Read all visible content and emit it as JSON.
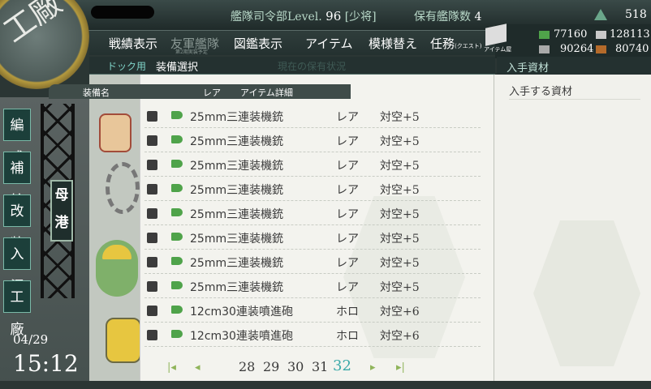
{
  "top": {
    "hq_label": "艦隊司令部Level.",
    "level": "96",
    "rank": "[少将]",
    "fleet_label": "保有艦隊数",
    "fleet_count": "4",
    "coins": "518"
  },
  "nav": {
    "items": [
      {
        "label": "戦績表示"
      },
      {
        "label": "友軍艦隊"
      },
      {
        "label": "図鑑表示"
      },
      {
        "label": "アイテム"
      },
      {
        "label": "模様替え"
      },
      {
        "label": "任務"
      }
    ],
    "friend_sub": "第2期実装予定",
    "quest_sub": "(クエスト)",
    "item_shop": "アイテム屋"
  },
  "resources": {
    "fuel": "77160",
    "ammo": "128113",
    "steel": "90264",
    "bauxite": "80740"
  },
  "crest": "工廠",
  "sub": {
    "dock": "ドック用",
    "equip": "装備選択",
    "faint": "現在の保有状況"
  },
  "right_title": "入手資材",
  "right_label": "入手する資材",
  "side": [
    "編成",
    "補給",
    "改装",
    "入渠",
    "工廠"
  ],
  "port": "母港",
  "clock": {
    "date": "04/29",
    "time": "15:12"
  },
  "table": {
    "col_name": "装備名",
    "col_rarity": "レア",
    "col_detail": "アイテム詳細",
    "rows": [
      {
        "name": "25mm三連装機銃",
        "rarity": "レア",
        "detail": "対空+5"
      },
      {
        "name": "25mm三連装機銃",
        "rarity": "レア",
        "detail": "対空+5"
      },
      {
        "name": "25mm三連装機銃",
        "rarity": "レア",
        "detail": "対空+5"
      },
      {
        "name": "25mm三連装機銃",
        "rarity": "レア",
        "detail": "対空+5"
      },
      {
        "name": "25mm三連装機銃",
        "rarity": "レア",
        "detail": "対空+5"
      },
      {
        "name": "25mm三連装機銃",
        "rarity": "レア",
        "detail": "対空+5"
      },
      {
        "name": "25mm三連装機銃",
        "rarity": "レア",
        "detail": "対空+5"
      },
      {
        "name": "25mm三連装機銃",
        "rarity": "レア",
        "detail": "対空+5"
      },
      {
        "name": "12cm30連装噴進砲",
        "rarity": "ホロ",
        "detail": "対空+6"
      },
      {
        "name": "12cm30連装噴進砲",
        "rarity": "ホロ",
        "detail": "対空+6"
      }
    ]
  },
  "pager": {
    "pages": [
      "28",
      "29",
      "30",
      "31",
      "32"
    ],
    "current": "32"
  },
  "colors": {
    "accent": "#3aa9a8",
    "header_bg": "#3f4c49",
    "panel": "#f3f3ee"
  }
}
